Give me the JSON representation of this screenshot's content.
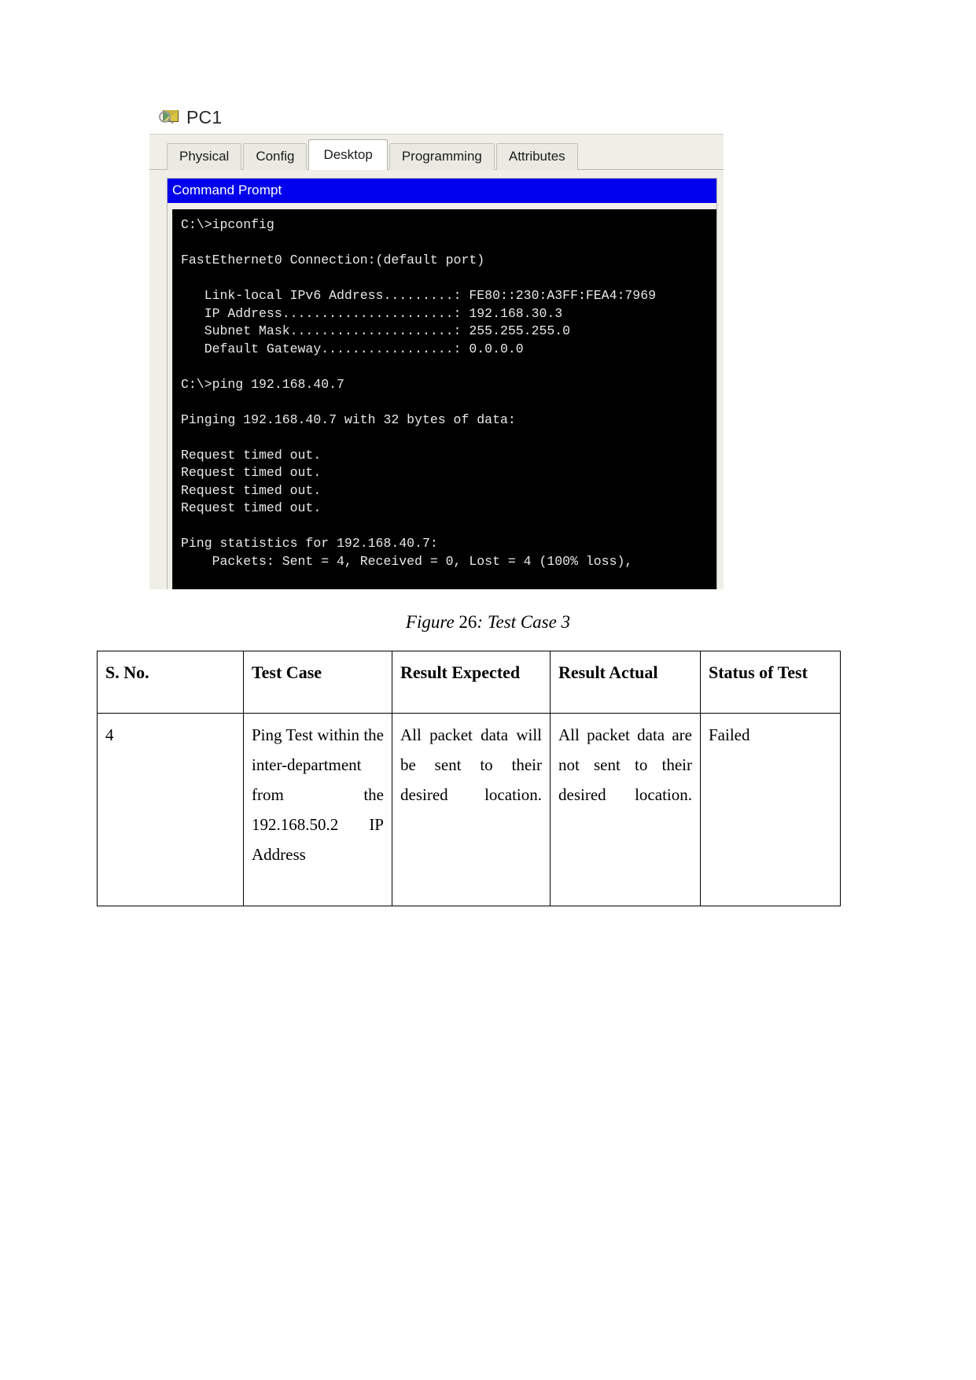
{
  "figure": {
    "device_name": "PC1",
    "device_icon": "packet-tracer-device-icon",
    "tabs": [
      {
        "label": "Physical",
        "active": false
      },
      {
        "label": "Config",
        "active": false
      },
      {
        "label": "Desktop",
        "active": true
      },
      {
        "label": "Programming",
        "active": false
      },
      {
        "label": "Attributes",
        "active": false
      }
    ],
    "command_prompt": {
      "title": "Command Prompt",
      "title_bg": "#0000ec",
      "console_bg": "#000000",
      "console_fg": "#e9e9e9",
      "lines": [
        "C:\\>ipconfig",
        "",
        "FastEthernet0 Connection:(default port)",
        "",
        "   Link-local IPv6 Address.........: FE80::230:A3FF:FEA4:7969",
        "   IP Address......................: 192.168.30.3",
        "   Subnet Mask.....................: 255.255.255.0",
        "   Default Gateway.................: 0.0.0.0",
        "",
        "C:\\>ping 192.168.40.7",
        "",
        "Pinging 192.168.40.7 with 32 bytes of data:",
        "",
        "Request timed out.",
        "Request timed out.",
        "Request timed out.",
        "Request timed out.",
        "",
        "Ping statistics for 192.168.40.7:",
        "    Packets: Sent = 4, Received = 0, Lost = 4 (100% loss),"
      ]
    },
    "caption_prefix": "Figure ",
    "caption_number": "26",
    "caption_suffix": ": Test Case 3"
  },
  "table": {
    "headers": [
      "S. No.",
      "Test Case",
      "Result Expected",
      "Result Actual",
      "Status of Test"
    ],
    "rows": [
      {
        "sno": "4",
        "test_case": "Ping Test within the inter-department from the 192.168.50.2 IP Address",
        "result_expected": "All packet data will be sent to their desired location.",
        "result_actual": "All packet data are not sent to their desired location.",
        "status": "Failed"
      }
    ]
  }
}
